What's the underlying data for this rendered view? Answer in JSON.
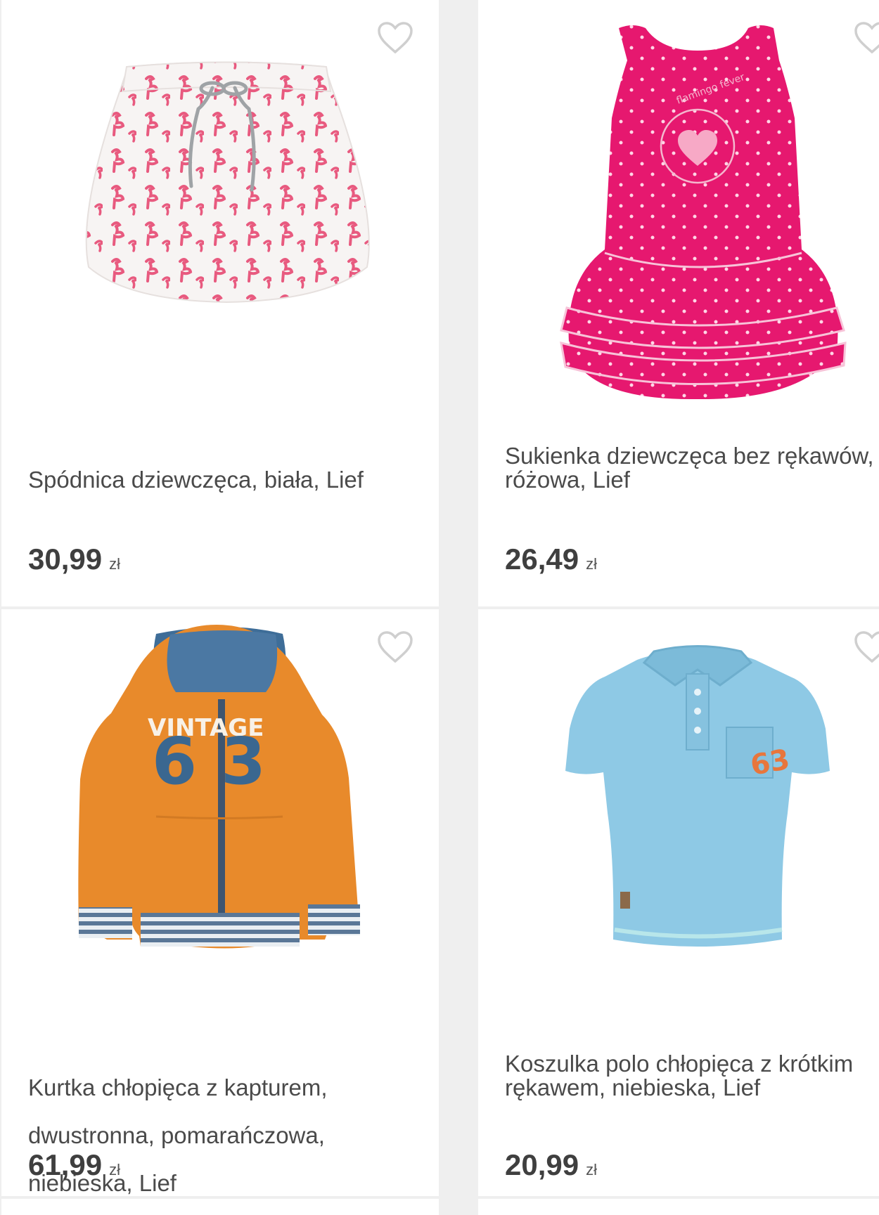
{
  "products": [
    {
      "title_line1": "Spódnica dziewczęca, biała, Lief",
      "title_line2": "",
      "title_line3": "",
      "price": "30,99",
      "currency": "zł",
      "image_icon": "skirt-flamingo-image",
      "favorite_icon": "heart-outline-icon"
    },
    {
      "title_line1": "Sukienka dziewczęca bez rękawów,",
      "title_line2": "różowa, Lief",
      "title_line3": "",
      "price": "26,49",
      "currency": "zł",
      "image_icon": "pink-dress-image",
      "image_text": "flamingo fever",
      "favorite_icon": "heart-outline-icon"
    },
    {
      "title_line1": "Kurtka chłopięca z kapturem,",
      "title_line2": "dwustronna, pomarańczowa,",
      "title_line3": "niebieska, Lief",
      "price": "61,99",
      "currency": "zł",
      "image_icon": "orange-hoodie-image",
      "image_text_top": "VINTAGE",
      "image_text_number": "63",
      "favorite_icon": "heart-outline-icon"
    },
    {
      "title_line1": "Koszulka polo chłopięca z krótkim",
      "title_line2": "rękawem, niebieska, Lief",
      "title_line3": "",
      "price": "20,99",
      "currency": "zł",
      "image_icon": "blue-polo-image",
      "image_text_number": "63",
      "favorite_icon": "heart-outline-icon"
    }
  ],
  "colors": {
    "page_background": "#efefef",
    "card_background": "#ffffff",
    "text": "#4a4a4a",
    "price": "#3f3f3f",
    "heart_outline": "#cfcfcf"
  }
}
